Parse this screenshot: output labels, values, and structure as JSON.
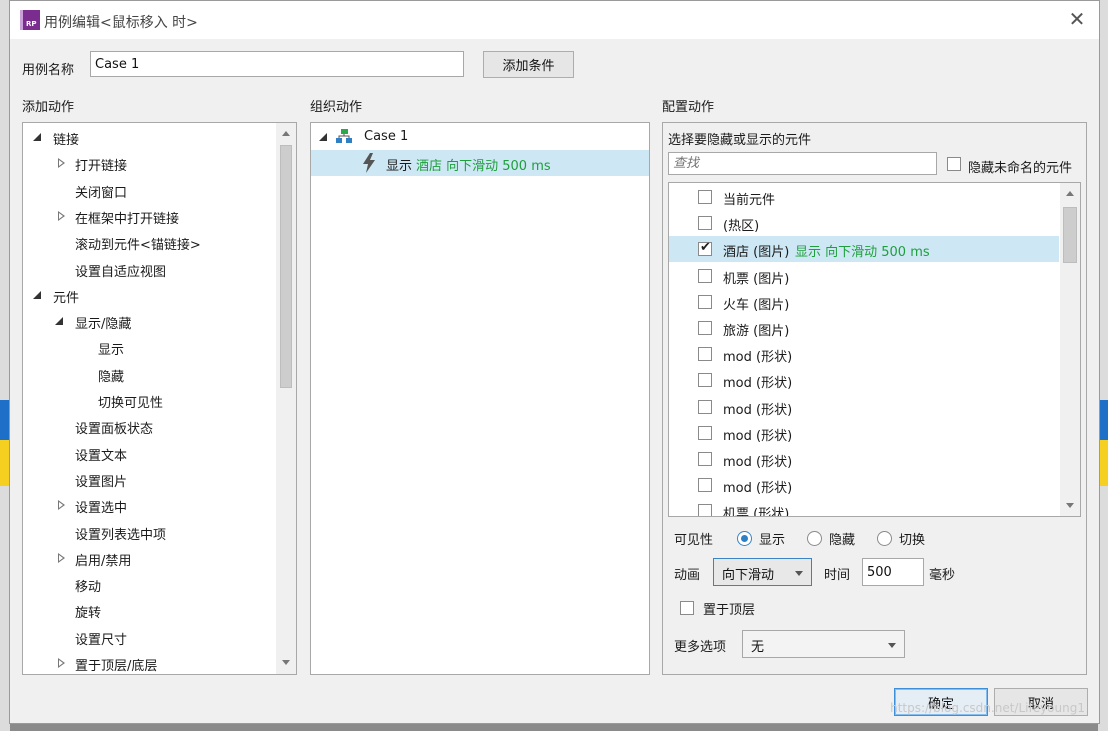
{
  "window": {
    "title": "用例编辑<鼠标移入 时>",
    "app_icon": "RP"
  },
  "case_name": {
    "label": "用例名称",
    "value": "Case 1",
    "add_condition": "添加条件"
  },
  "add_actions": {
    "header": "添加动作",
    "items": [
      {
        "label": "链接",
        "expander": "open"
      },
      {
        "label": "打开链接",
        "expander": "closed"
      },
      {
        "label": "关闭窗口",
        "expander": "none"
      },
      {
        "label": "在框架中打开链接",
        "expander": "closed"
      },
      {
        "label": "滚动到元件<锚链接>",
        "expander": "none"
      },
      {
        "label": "设置自适应视图",
        "expander": "none"
      },
      {
        "label": "元件",
        "expander": "open"
      },
      {
        "label": "显示/隐藏",
        "expander": "open"
      },
      {
        "label": "显示",
        "expander": "none"
      },
      {
        "label": "隐藏",
        "expander": "none"
      },
      {
        "label": "切换可见性",
        "expander": "none"
      },
      {
        "label": "设置面板状态",
        "expander": "none"
      },
      {
        "label": "设置文本",
        "expander": "none"
      },
      {
        "label": "设置图片",
        "expander": "none"
      },
      {
        "label": "设置选中",
        "expander": "closed"
      },
      {
        "label": "设置列表选中项",
        "expander": "none"
      },
      {
        "label": "启用/禁用",
        "expander": "closed"
      },
      {
        "label": "移动",
        "expander": "none"
      },
      {
        "label": "旋转",
        "expander": "none"
      },
      {
        "label": "设置尺寸",
        "expander": "none"
      },
      {
        "label": "置于顶层/底层",
        "expander": "closed"
      }
    ]
  },
  "organize_actions": {
    "header": "组织动作",
    "case_label": "Case 1",
    "action_verb": "显示",
    "action_detail": "酒店 向下滑动 500 ms"
  },
  "config_actions": {
    "header": "配置动作",
    "subheader": "选择要隐藏或显示的元件",
    "search_placeholder": "查找",
    "hide_unnamed_label": "隐藏未命名的元件",
    "elements": [
      {
        "label": "当前元件",
        "checked": false,
        "status": ""
      },
      {
        "label": "(热区)",
        "checked": false,
        "status": ""
      },
      {
        "label": "酒店 (图片)",
        "checked": true,
        "status": "显示 向下滑动 500 ms"
      },
      {
        "label": "机票 (图片)",
        "checked": false,
        "status": ""
      },
      {
        "label": "火车 (图片)",
        "checked": false,
        "status": ""
      },
      {
        "label": "旅游 (图片)",
        "checked": false,
        "status": ""
      },
      {
        "label": "mod (形状)",
        "checked": false,
        "status": ""
      },
      {
        "label": "mod (形状)",
        "checked": false,
        "status": ""
      },
      {
        "label": "mod (形状)",
        "checked": false,
        "status": ""
      },
      {
        "label": "mod (形状)",
        "checked": false,
        "status": ""
      },
      {
        "label": "mod (形状)",
        "checked": false,
        "status": ""
      },
      {
        "label": "mod (形状)",
        "checked": false,
        "status": ""
      },
      {
        "label": "机票 (形状)",
        "checked": false,
        "status": ""
      }
    ],
    "visibility": {
      "label": "可见性",
      "options": [
        "显示",
        "隐藏",
        "切换"
      ],
      "selected": "显示"
    },
    "animation": {
      "label": "动画",
      "value": "向下滑动",
      "time_label": "时间",
      "time_value": "500",
      "unit": "毫秒"
    },
    "bring_to_front": "置于顶层",
    "more_options": {
      "label": "更多选项",
      "value": "无"
    }
  },
  "footer": {
    "ok": "确定",
    "cancel": "取消",
    "watermark": "https://blog.csdn.net/Lifeyoung1"
  },
  "colors": {
    "accent": "#2f7fc4",
    "highlight": "#cde8f4",
    "status_green": "#1e9e3c",
    "icon_purple": "#7b2c8f"
  }
}
